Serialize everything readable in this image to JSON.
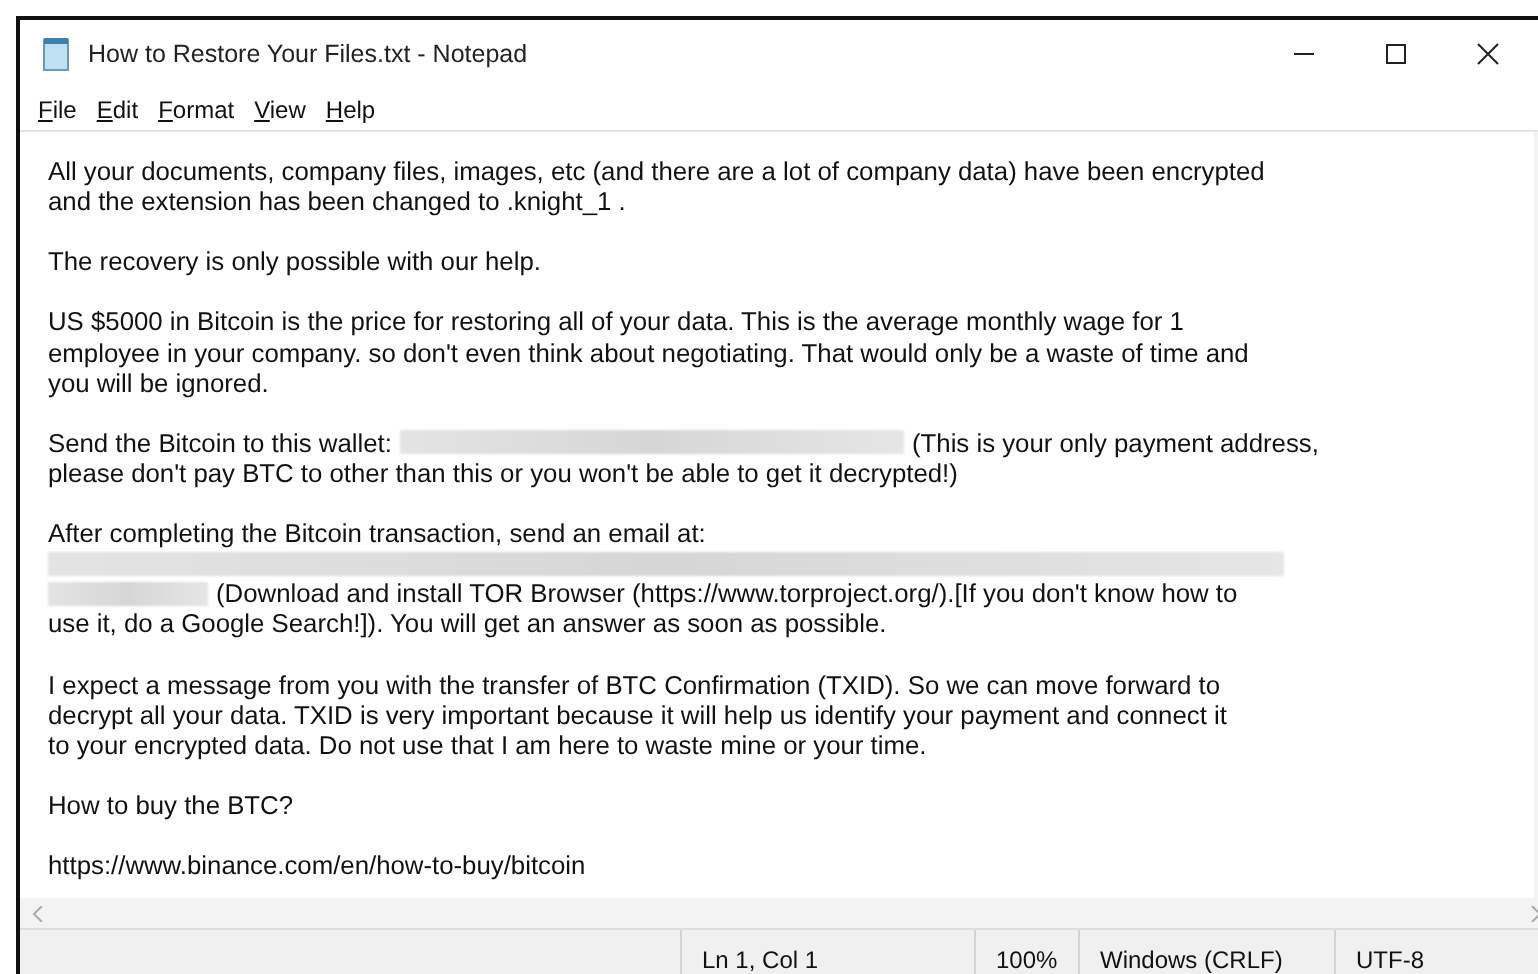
{
  "window": {
    "title": "How to Restore Your Files.txt - Notepad"
  },
  "menu": [
    {
      "label": "File"
    },
    {
      "label": "Edit"
    },
    {
      "label": "Format"
    },
    {
      "label": "View"
    },
    {
      "label": "Help"
    }
  ],
  "lines": [
    {
      "kind": "text",
      "segments": [
        {
          "kind": "text",
          "text": "All your documents, company files, images, etc (and there are a lot of company data) have been encrypted"
        }
      ]
    },
    {
      "kind": "text",
      "segments": [
        {
          "kind": "text",
          "text": "and the extension has been changed to .knight_1 ."
        }
      ]
    },
    {
      "kind": "blank"
    },
    {
      "kind": "text",
      "segments": [
        {
          "kind": "text",
          "text": "The recovery is only possible with our help."
        }
      ]
    },
    {
      "kind": "blank"
    },
    {
      "kind": "text",
      "segments": [
        {
          "kind": "text",
          "text": "US $5000 in Bitcoin is the price for restoring all of your data. This is the average monthly wage for 1"
        }
      ]
    },
    {
      "kind": "text",
      "segments": [
        {
          "kind": "text",
          "text": "employee in your company. so don't even think about negotiating. That would only be a waste of time and"
        }
      ]
    },
    {
      "kind": "text",
      "segments": [
        {
          "kind": "text",
          "text": "you will be ignored."
        }
      ]
    },
    {
      "kind": "blank"
    },
    {
      "kind": "text",
      "segments": [
        {
          "kind": "text",
          "text": "Send the Bitcoin to this wallet:"
        },
        {
          "kind": "redaction"
        },
        {
          "kind": "text",
          "text": "(This is your only payment address,"
        }
      ]
    },
    {
      "kind": "text",
      "segments": [
        {
          "kind": "text",
          "text": "please don't pay BTC to other than this or you won't be able to get it decrypted!)"
        }
      ]
    },
    {
      "kind": "blank"
    },
    {
      "kind": "text",
      "segments": [
        {
          "kind": "text",
          "text": "After completing the Bitcoin transaction, send an email at:"
        }
      ]
    },
    {
      "kind": "text",
      "segments": [
        {
          "kind": "fullredaction"
        }
      ]
    },
    {
      "kind": "text",
      "segments": [
        {
          "kind": "shortredaction"
        },
        {
          "kind": "text",
          "text": "(Download and install TOR Browser (https://www.torproject.org/).[If you don't know how to"
        }
      ]
    },
    {
      "kind": "text",
      "segments": [
        {
          "kind": "text",
          "text": "use it, do a Google Search!]). You will get an answer as soon as possible."
        }
      ]
    },
    {
      "kind": "blank"
    },
    {
      "kind": "text",
      "segments": [
        {
          "kind": "text",
          "text": "I expect a message from you with the transfer of BTC Confirmation (TXID). So we can move forward to"
        }
      ]
    },
    {
      "kind": "text",
      "segments": [
        {
          "kind": "text",
          "text": "decrypt all your data. TXID is very important because it will help us identify your payment and connect it"
        }
      ]
    },
    {
      "kind": "text",
      "segments": [
        {
          "kind": "text",
          "text": "to your encrypted data. Do not use that I am here to waste mine or your time."
        }
      ]
    },
    {
      "kind": "blank"
    },
    {
      "kind": "text",
      "segments": [
        {
          "kind": "text",
          "text": "How to buy the BTC?"
        }
      ]
    },
    {
      "kind": "blank"
    },
    {
      "kind": "text",
      "segments": [
        {
          "kind": "text",
          "text": "https://www.binance.com/en/how-to-buy/bitcoin"
        }
      ]
    }
  ],
  "status_bar": {
    "position": "Ln 1, Col 1",
    "zoom": "100%",
    "line_ending": "Windows (CRLF)",
    "encoding": "UTF-8"
  }
}
